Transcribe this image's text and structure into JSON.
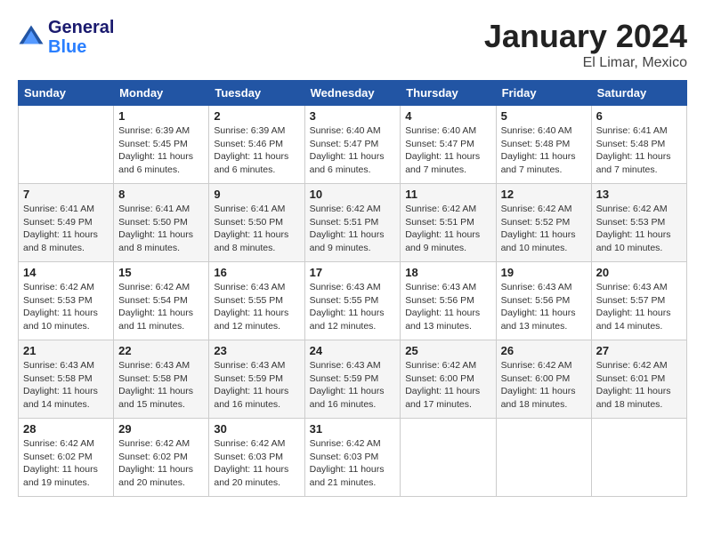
{
  "header": {
    "logo_line1": "General",
    "logo_line2": "Blue",
    "month_title": "January 2024",
    "location": "El Limar, Mexico"
  },
  "weekdays": [
    "Sunday",
    "Monday",
    "Tuesday",
    "Wednesday",
    "Thursday",
    "Friday",
    "Saturday"
  ],
  "weeks": [
    [
      {
        "day": "",
        "sunrise": "",
        "sunset": "",
        "daylight": ""
      },
      {
        "day": "1",
        "sunrise": "Sunrise: 6:39 AM",
        "sunset": "Sunset: 5:45 PM",
        "daylight": "Daylight: 11 hours and 6 minutes."
      },
      {
        "day": "2",
        "sunrise": "Sunrise: 6:39 AM",
        "sunset": "Sunset: 5:46 PM",
        "daylight": "Daylight: 11 hours and 6 minutes."
      },
      {
        "day": "3",
        "sunrise": "Sunrise: 6:40 AM",
        "sunset": "Sunset: 5:47 PM",
        "daylight": "Daylight: 11 hours and 6 minutes."
      },
      {
        "day": "4",
        "sunrise": "Sunrise: 6:40 AM",
        "sunset": "Sunset: 5:47 PM",
        "daylight": "Daylight: 11 hours and 7 minutes."
      },
      {
        "day": "5",
        "sunrise": "Sunrise: 6:40 AM",
        "sunset": "Sunset: 5:48 PM",
        "daylight": "Daylight: 11 hours and 7 minutes."
      },
      {
        "day": "6",
        "sunrise": "Sunrise: 6:41 AM",
        "sunset": "Sunset: 5:48 PM",
        "daylight": "Daylight: 11 hours and 7 minutes."
      }
    ],
    [
      {
        "day": "7",
        "sunrise": "Sunrise: 6:41 AM",
        "sunset": "Sunset: 5:49 PM",
        "daylight": "Daylight: 11 hours and 8 minutes."
      },
      {
        "day": "8",
        "sunrise": "Sunrise: 6:41 AM",
        "sunset": "Sunset: 5:50 PM",
        "daylight": "Daylight: 11 hours and 8 minutes."
      },
      {
        "day": "9",
        "sunrise": "Sunrise: 6:41 AM",
        "sunset": "Sunset: 5:50 PM",
        "daylight": "Daylight: 11 hours and 8 minutes."
      },
      {
        "day": "10",
        "sunrise": "Sunrise: 6:42 AM",
        "sunset": "Sunset: 5:51 PM",
        "daylight": "Daylight: 11 hours and 9 minutes."
      },
      {
        "day": "11",
        "sunrise": "Sunrise: 6:42 AM",
        "sunset": "Sunset: 5:51 PM",
        "daylight": "Daylight: 11 hours and 9 minutes."
      },
      {
        "day": "12",
        "sunrise": "Sunrise: 6:42 AM",
        "sunset": "Sunset: 5:52 PM",
        "daylight": "Daylight: 11 hours and 10 minutes."
      },
      {
        "day": "13",
        "sunrise": "Sunrise: 6:42 AM",
        "sunset": "Sunset: 5:53 PM",
        "daylight": "Daylight: 11 hours and 10 minutes."
      }
    ],
    [
      {
        "day": "14",
        "sunrise": "Sunrise: 6:42 AM",
        "sunset": "Sunset: 5:53 PM",
        "daylight": "Daylight: 11 hours and 10 minutes."
      },
      {
        "day": "15",
        "sunrise": "Sunrise: 6:42 AM",
        "sunset": "Sunset: 5:54 PM",
        "daylight": "Daylight: 11 hours and 11 minutes."
      },
      {
        "day": "16",
        "sunrise": "Sunrise: 6:43 AM",
        "sunset": "Sunset: 5:55 PM",
        "daylight": "Daylight: 11 hours and 12 minutes."
      },
      {
        "day": "17",
        "sunrise": "Sunrise: 6:43 AM",
        "sunset": "Sunset: 5:55 PM",
        "daylight": "Daylight: 11 hours and 12 minutes."
      },
      {
        "day": "18",
        "sunrise": "Sunrise: 6:43 AM",
        "sunset": "Sunset: 5:56 PM",
        "daylight": "Daylight: 11 hours and 13 minutes."
      },
      {
        "day": "19",
        "sunrise": "Sunrise: 6:43 AM",
        "sunset": "Sunset: 5:56 PM",
        "daylight": "Daylight: 11 hours and 13 minutes."
      },
      {
        "day": "20",
        "sunrise": "Sunrise: 6:43 AM",
        "sunset": "Sunset: 5:57 PM",
        "daylight": "Daylight: 11 hours and 14 minutes."
      }
    ],
    [
      {
        "day": "21",
        "sunrise": "Sunrise: 6:43 AM",
        "sunset": "Sunset: 5:58 PM",
        "daylight": "Daylight: 11 hours and 14 minutes."
      },
      {
        "day": "22",
        "sunrise": "Sunrise: 6:43 AM",
        "sunset": "Sunset: 5:58 PM",
        "daylight": "Daylight: 11 hours and 15 minutes."
      },
      {
        "day": "23",
        "sunrise": "Sunrise: 6:43 AM",
        "sunset": "Sunset: 5:59 PM",
        "daylight": "Daylight: 11 hours and 16 minutes."
      },
      {
        "day": "24",
        "sunrise": "Sunrise: 6:43 AM",
        "sunset": "Sunset: 5:59 PM",
        "daylight": "Daylight: 11 hours and 16 minutes."
      },
      {
        "day": "25",
        "sunrise": "Sunrise: 6:42 AM",
        "sunset": "Sunset: 6:00 PM",
        "daylight": "Daylight: 11 hours and 17 minutes."
      },
      {
        "day": "26",
        "sunrise": "Sunrise: 6:42 AM",
        "sunset": "Sunset: 6:00 PM",
        "daylight": "Daylight: 11 hours and 18 minutes."
      },
      {
        "day": "27",
        "sunrise": "Sunrise: 6:42 AM",
        "sunset": "Sunset: 6:01 PM",
        "daylight": "Daylight: 11 hours and 18 minutes."
      }
    ],
    [
      {
        "day": "28",
        "sunrise": "Sunrise: 6:42 AM",
        "sunset": "Sunset: 6:02 PM",
        "daylight": "Daylight: 11 hours and 19 minutes."
      },
      {
        "day": "29",
        "sunrise": "Sunrise: 6:42 AM",
        "sunset": "Sunset: 6:02 PM",
        "daylight": "Daylight: 11 hours and 20 minutes."
      },
      {
        "day": "30",
        "sunrise": "Sunrise: 6:42 AM",
        "sunset": "Sunset: 6:03 PM",
        "daylight": "Daylight: 11 hours and 20 minutes."
      },
      {
        "day": "31",
        "sunrise": "Sunrise: 6:42 AM",
        "sunset": "Sunset: 6:03 PM",
        "daylight": "Daylight: 11 hours and 21 minutes."
      },
      {
        "day": "",
        "sunrise": "",
        "sunset": "",
        "daylight": ""
      },
      {
        "day": "",
        "sunrise": "",
        "sunset": "",
        "daylight": ""
      },
      {
        "day": "",
        "sunrise": "",
        "sunset": "",
        "daylight": ""
      }
    ]
  ]
}
